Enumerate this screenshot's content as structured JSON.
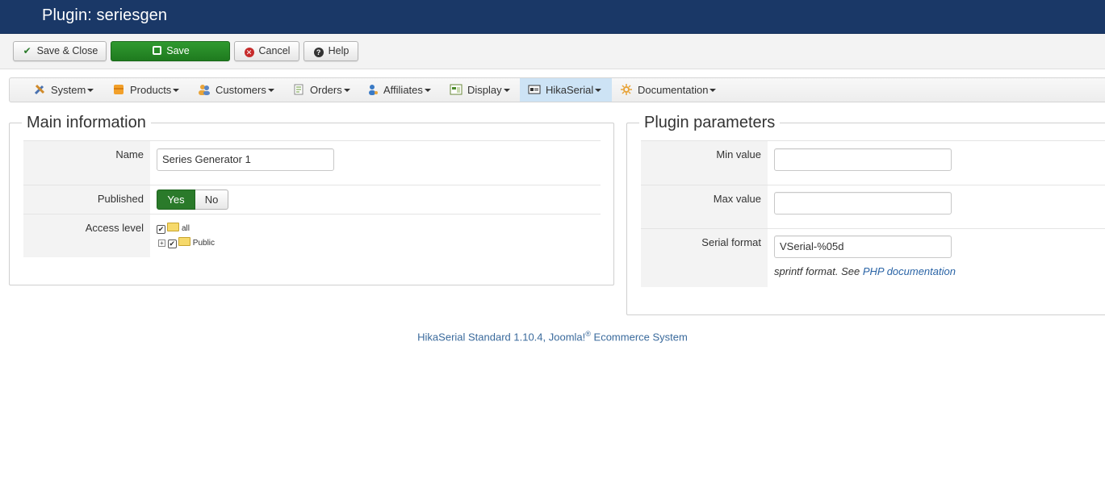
{
  "page_title": "Plugin: seriesgen",
  "toolbar": {
    "save_close": "Save & Close",
    "save": "Save",
    "cancel": "Cancel",
    "help": "Help"
  },
  "menu": [
    {
      "label": "System",
      "icon": "tools-icon"
    },
    {
      "label": "Products",
      "icon": "box-icon"
    },
    {
      "label": "Customers",
      "icon": "users-icon"
    },
    {
      "label": "Orders",
      "icon": "orders-icon"
    },
    {
      "label": "Affiliates",
      "icon": "affiliate-icon"
    },
    {
      "label": "Display",
      "icon": "display-icon"
    },
    {
      "label": "HikaSerial",
      "icon": "serial-icon",
      "active": true
    },
    {
      "label": "Documentation",
      "icon": "docs-icon"
    }
  ],
  "main_info": {
    "legend": "Main information",
    "name_label": "Name",
    "name_value": "Series Generator 1",
    "published_label": "Published",
    "published_yes": "Yes",
    "published_no": "No",
    "published_value": "Yes",
    "access_label": "Access level",
    "access_tree": [
      {
        "label": "all",
        "checked": true
      },
      {
        "label": "Public",
        "checked": true
      }
    ]
  },
  "plugin_params": {
    "legend": "Plugin parameters",
    "min_label": "Min value",
    "min_value": "",
    "max_label": "Max value",
    "max_value": "",
    "serial_label": "Serial format",
    "serial_value": "VSerial-%05d",
    "hint_text": "sprintf format. See ",
    "hint_link": "PHP documentation"
  },
  "footer": {
    "text": "HikaSerial Standard 1.10.4, Joomla!",
    "sup": "®",
    "text_after": " Ecommerce System"
  },
  "colors": {
    "header_bg": "#1a3867",
    "save_green": "#2a7a2a",
    "active_menu": "#cde3f5",
    "link": "#2a64a6"
  }
}
